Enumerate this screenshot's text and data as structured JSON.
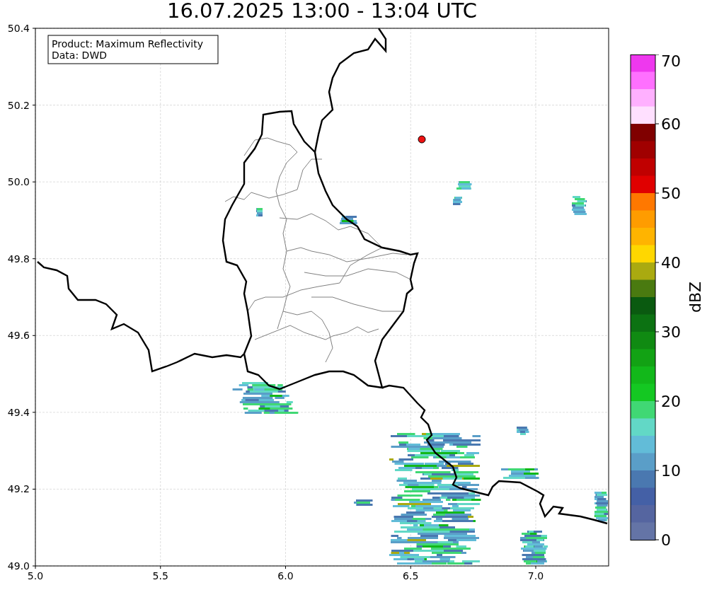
{
  "title": "16.07.2025 13:00 - 13:04 UTC",
  "info_box": {
    "lines": [
      "Product: Maximum Reflectivity",
      "Data: DWD"
    ]
  },
  "map": {
    "x_tick_labels": [
      "5.0",
      "5.5",
      "6.0",
      "6.5",
      "7.0"
    ],
    "y_tick_labels": [
      "50.4",
      "50.2",
      "50.0",
      "49.8",
      "49.6",
      "49.4",
      "49.2",
      "49.0"
    ]
  },
  "colorbar": {
    "label": "dBZ",
    "ticks": [
      "70",
      "60",
      "50",
      "40",
      "30",
      "20",
      "10",
      "0"
    ],
    "segments": [
      {
        "color": "#ee38ee"
      },
      {
        "color": "#ff70ff"
      },
      {
        "color": "#ffb0ff"
      },
      {
        "color": "#ffe0ff"
      },
      {
        "color": "#800000"
      },
      {
        "color": "#a00000"
      },
      {
        "color": "#c00000"
      },
      {
        "color": "#e00000"
      },
      {
        "color": "#ff7800"
      },
      {
        "color": "#ff9c00"
      },
      {
        "color": "#ffb400"
      },
      {
        "color": "#ffd700"
      },
      {
        "color": "#aaaa10"
      },
      {
        "color": "#4a7a10"
      },
      {
        "color": "#0a5a10"
      },
      {
        "color": "#0c7212"
      },
      {
        "color": "#108a12"
      },
      {
        "color": "#12a214"
      },
      {
        "color": "#12b81a"
      },
      {
        "color": "#14c822"
      },
      {
        "color": "#40d874"
      },
      {
        "color": "#62d8c6"
      },
      {
        "color": "#62bcd8"
      },
      {
        "color": "#5a9ec8"
      },
      {
        "color": "#4a78b0"
      },
      {
        "color": "#4460a6"
      },
      {
        "color": "#5565a0"
      },
      {
        "color": "#6474a6"
      }
    ]
  }
}
